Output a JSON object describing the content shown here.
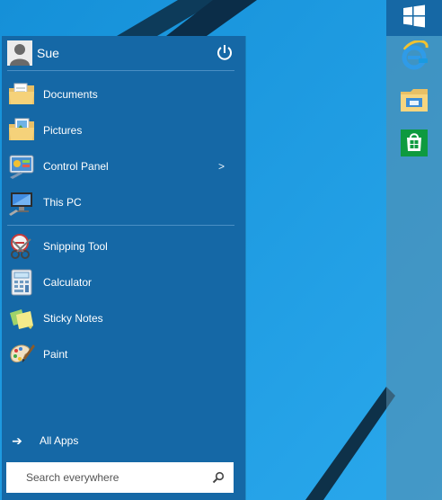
{
  "user": {
    "name": "Sue"
  },
  "pinned": [
    {
      "label": "Documents",
      "icon": "documents-folder-icon"
    },
    {
      "label": "Pictures",
      "icon": "pictures-folder-icon"
    },
    {
      "label": "Control Panel",
      "icon": "control-panel-icon",
      "submenu": ">"
    },
    {
      "label": "This PC",
      "icon": "this-pc-icon"
    }
  ],
  "recent": [
    {
      "label": "Snipping Tool",
      "icon": "snipping-tool-icon"
    },
    {
      "label": "Calculator",
      "icon": "calculator-icon"
    },
    {
      "label": "Sticky Notes",
      "icon": "sticky-notes-icon"
    },
    {
      "label": "Paint",
      "icon": "paint-icon"
    }
  ],
  "all_apps": {
    "label": "All Apps",
    "arrow": "➔"
  },
  "search": {
    "placeholder": "Search everywhere"
  },
  "taskbar": {
    "items": [
      "windows-start-icon",
      "internet-explorer-icon",
      "file-explorer-icon",
      "store-icon"
    ]
  },
  "colors": {
    "desktop": "#1a9ae0",
    "menu": "#1568a6",
    "divider": "#4a8fc4",
    "taskbar": "#5a8caa"
  }
}
